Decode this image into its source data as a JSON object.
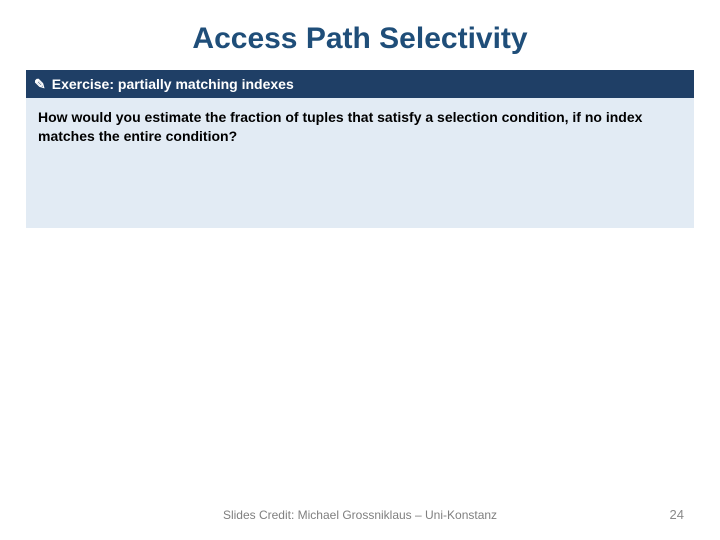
{
  "title": "Access Path Selectivity",
  "exercise": {
    "icon_glyph": "✎",
    "header": "Exercise: partially matching indexes",
    "body": "How would you estimate the fraction of tuples that satisfy a selection condition, if no index matches the entire condition?"
  },
  "footer": {
    "credit": "Slides Credit: Michael Grossniklaus – Uni-Konstanz",
    "page_number": "24"
  }
}
